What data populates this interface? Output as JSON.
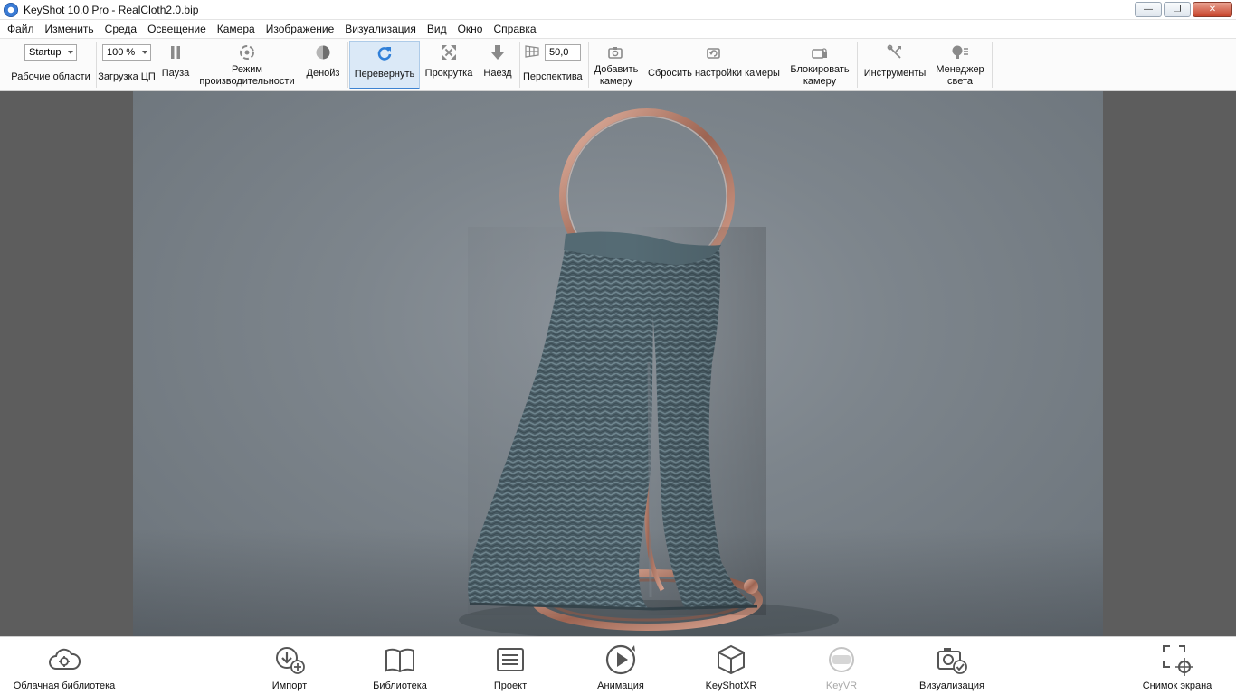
{
  "window": {
    "title": "KeyShot 10.0 Pro  -  RealCloth2.0.bip",
    "minimize_glyph": "—",
    "restore_glyph": "❐",
    "close_glyph": "✕"
  },
  "menu": [
    "Файл",
    "Изменить",
    "Среда",
    "Освещение",
    "Камера",
    "Изображение",
    "Визуализация",
    "Вид",
    "Окно",
    "Справка"
  ],
  "toolbar": {
    "workspace_value": "Startup",
    "workspace_label": "Рабочие области",
    "cpu_value": "100 %",
    "cpu_label": "Загрузка ЦП",
    "pause_label": "Пауза",
    "perf_label_1": "Режим",
    "perf_label_2": "производительности",
    "denoise_label": "Денойз",
    "tumble_label": "Перевернуть",
    "pan_label": "Прокрутка",
    "dolly_label": "Наезд",
    "perspective_value": "50,0",
    "perspective_label": "Перспектива",
    "add_camera_label_1": "Добавить",
    "add_camera_label_2": "камеру",
    "reset_camera_label": "Сбросить настройки камеры",
    "lock_camera_label_1": "Блокировать",
    "lock_camera_label_2": "камеру",
    "tools_label": "Инструменты",
    "light_manager_label_1": "Менеджер",
    "light_manager_label_2": "света"
  },
  "bottom": {
    "cloud_library": "Облачная библиотека",
    "import": "Импорт",
    "library": "Библиотека",
    "project": "Проект",
    "animation": "Анимация",
    "keyshotxr": "KeyShotXR",
    "keyvr": "KeyVR",
    "render": "Визуализация",
    "screenshot": "Снимок экрана"
  },
  "icons": {
    "app": "keyshot-logo-icon",
    "pause": "pause-icon",
    "performance": "performance-mode-icon",
    "denoise": "denoise-icon",
    "tumble": "tumble-icon",
    "pan": "pan-icon",
    "dolly": "dolly-icon",
    "perspective": "perspective-grid-icon"
  },
  "colors": {
    "accent": "#3d83d2",
    "active_tool_bg": "#dbe9f7",
    "viewport_bg": "#5d5d5d",
    "copper": "#b07a66",
    "cloth": "#4b5f66"
  }
}
